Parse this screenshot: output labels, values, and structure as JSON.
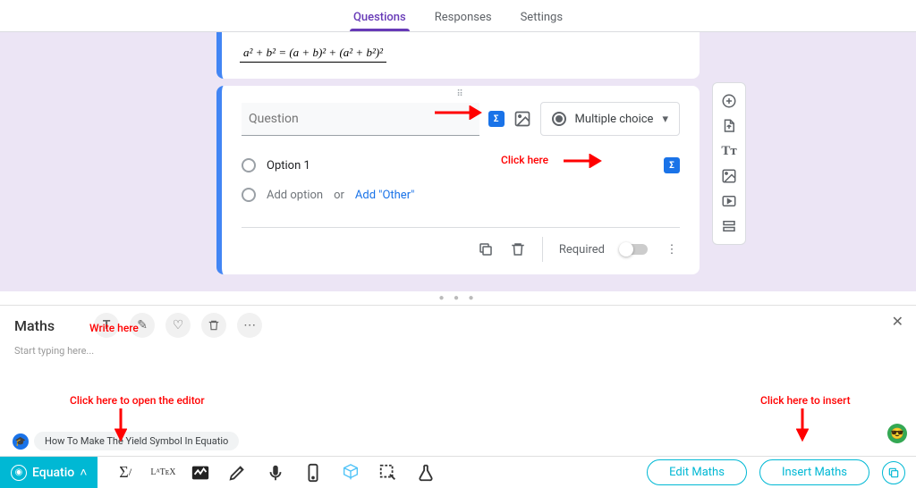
{
  "tabs": {
    "questions": "Questions",
    "responses": "Responses",
    "settings": "Settings"
  },
  "math_expr": "a² + b² = (a + b)² + (a² + b²)²",
  "question": {
    "placeholder": "Question",
    "type_label": "Multiple choice"
  },
  "options": {
    "opt1": "Option 1",
    "add": "Add option",
    "or": "or",
    "other": "Add \"Other\""
  },
  "footer": {
    "required": "Required"
  },
  "annotations": {
    "click_here": "Click here",
    "write_here": "Write here",
    "open_editor": "Click here to open the editor",
    "to_insert": "Click here to insert"
  },
  "equatio": {
    "title": "Maths",
    "hint": "Start typing here...",
    "brand": "Equatio",
    "edit": "Edit Maths",
    "insert": "Insert Maths",
    "latex": "LᴬTᴇX"
  },
  "help_text": "How To Make The Yield Symbol In Equatio"
}
